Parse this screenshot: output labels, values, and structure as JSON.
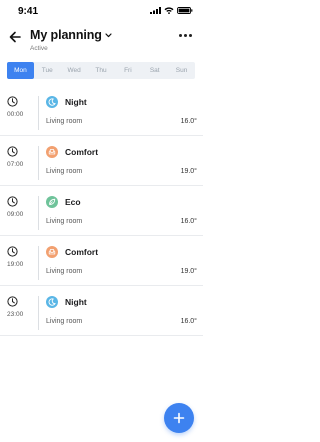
{
  "status_bar": {
    "time": "9:41"
  },
  "header": {
    "title": "My planning",
    "subtitle": "Active"
  },
  "days": [
    {
      "label": "Mon",
      "active": true
    },
    {
      "label": "Tue",
      "active": false
    },
    {
      "label": "Wed",
      "active": false
    },
    {
      "label": "Thu",
      "active": false
    },
    {
      "label": "Fri",
      "active": false
    },
    {
      "label": "Sat",
      "active": false
    },
    {
      "label": "Sun",
      "active": false
    }
  ],
  "schedule": [
    {
      "time": "00:00",
      "mode": "Night",
      "icon": "moon-icon",
      "color": "#5ab6e6",
      "room": "Living room",
      "temp": "16.0°"
    },
    {
      "time": "07:00",
      "mode": "Comfort",
      "icon": "sofa-icon",
      "color": "#f2a070",
      "room": "Living room",
      "temp": "19.0°"
    },
    {
      "time": "09:00",
      "mode": "Eco",
      "icon": "leaf-icon",
      "color": "#6fc39a",
      "room": "Living room",
      "temp": "16.0°"
    },
    {
      "time": "19:00",
      "mode": "Comfort",
      "icon": "sofa-icon",
      "color": "#f2a070",
      "room": "Living room",
      "temp": "19.0°"
    },
    {
      "time": "23:00",
      "mode": "Night",
      "icon": "moon-icon",
      "color": "#5ab6e6",
      "room": "Living room",
      "temp": "16.0°"
    }
  ],
  "fab": {
    "icon": "plus-icon",
    "color": "#3d82f0"
  }
}
